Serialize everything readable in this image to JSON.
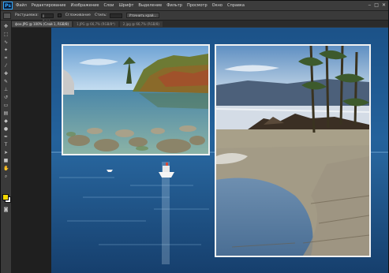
{
  "app": {
    "logo": "Ps"
  },
  "menubar": {
    "items": [
      "Файл",
      "Редактирование",
      "Изображение",
      "Слои",
      "Шрифт",
      "Выделение",
      "Фильтр",
      "Просмотр",
      "Окно",
      "Справка"
    ]
  },
  "options": {
    "label1": "Растушевка:",
    "value1": "0 пикс",
    "label2": "Сглаживание",
    "label3": "Стиль:",
    "button": "Уточнить край..."
  },
  "tabs": [
    {
      "label": "фон.JPG @ 100% (Слой 1, RGB/8)",
      "active": true
    },
    {
      "label": "1.JPG @ 66,7% (RGB/8*)",
      "active": false
    },
    {
      "label": "2.jpg @ 66,7% (RGB/8)",
      "active": false
    }
  ],
  "colors": {
    "foreground": "#f5d800",
    "background": "#ffffff",
    "canvas_bg": "#1e4f7e"
  }
}
